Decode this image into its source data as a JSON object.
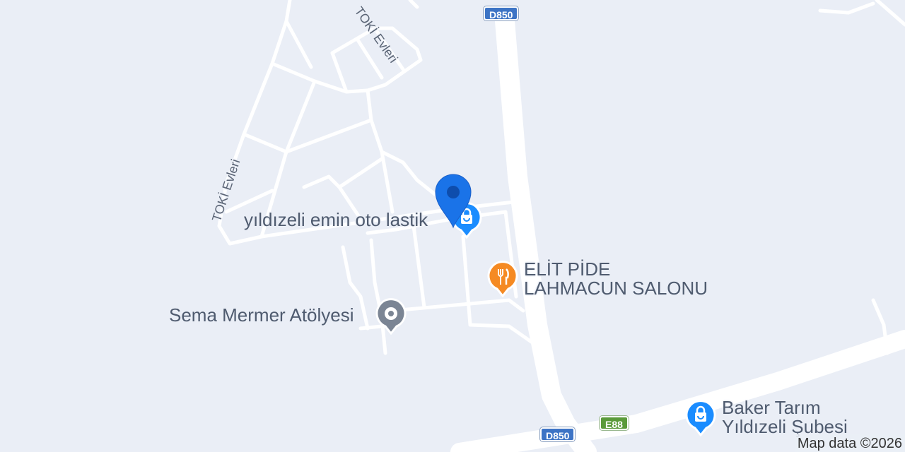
{
  "map": {
    "background_color": "#eaeef6",
    "road_color": "#ffffff"
  },
  "shields": [
    {
      "id": "d850-top",
      "text": "D850",
      "color": "#3d74c5"
    },
    {
      "id": "d850-bottom",
      "text": "D850",
      "color": "#3d74c5"
    },
    {
      "id": "e88",
      "text": "E88",
      "color": "#5a9a3a"
    }
  ],
  "street_labels": [
    {
      "id": "toki-evleri-1",
      "text": "TOKİ Evleri"
    },
    {
      "id": "toki-evleri-2",
      "text": "TOKİ Evleri"
    }
  ],
  "pois": [
    {
      "id": "emin-oto-lastik",
      "name": "yıldızeli emin oto lastik",
      "category": "shopping",
      "icon": "shopping-bag-icon",
      "color": "#1a8cff"
    },
    {
      "id": "elit-pide",
      "name_line1": "ELİT PİDE",
      "name_line2": "LAHMACUN SALONU",
      "category": "restaurant",
      "icon": "fork-knife-icon",
      "color": "#f58a23"
    },
    {
      "id": "sema-mermer",
      "name": "Sema Mermer Atölyesi",
      "category": "generic",
      "icon": "place-dot-icon",
      "color": "#7b8594"
    },
    {
      "id": "baker-tarim",
      "name_line1": "Baker Tarım",
      "name_line2": "Yıldızeli Şubesi",
      "category": "shopping",
      "icon": "shopping-bag-icon",
      "color": "#1a8cff"
    }
  ],
  "location_pin": {
    "icon": "location-pin-icon",
    "color": "#1a73e8"
  },
  "attribution": "Map data ©2026"
}
